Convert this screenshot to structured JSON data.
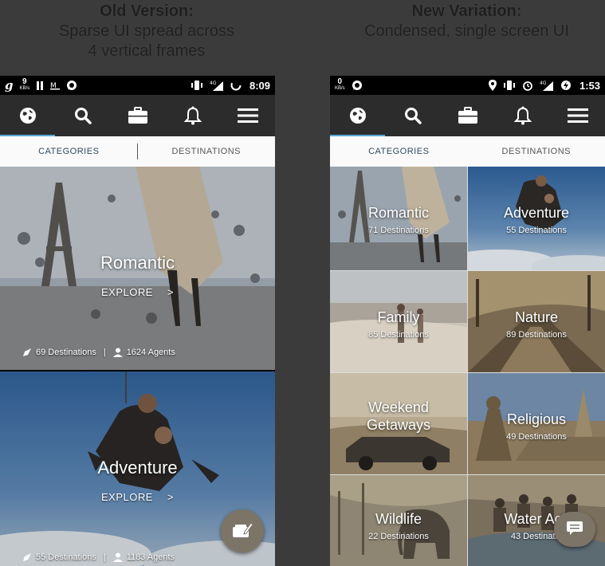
{
  "headings": {
    "old": {
      "title": "Old Version:",
      "line1": "Sparse UI spread across",
      "line2": "4 vertical frames"
    },
    "new": {
      "title": "New Variation:",
      "line1": "Condensed, single screen UI"
    }
  },
  "old_phone": {
    "status": {
      "left_g": "g",
      "kbs_value": "9",
      "kbs_unit": "KB/s",
      "network": "4G",
      "time": "8:09"
    },
    "tabs": {
      "categories": "CATEGORIES",
      "destinations": "DESTINATIONS"
    },
    "cards": [
      {
        "title": "Romantic",
        "explore": "EXPLORE",
        "chevron": ">",
        "destinations": "69 Destinations",
        "separator": "|",
        "agents": "1624 Agents"
      },
      {
        "title": "Adventure",
        "explore": "EXPLORE",
        "chevron": ">",
        "destinations": "55 Destinations",
        "separator": "|",
        "agents": "1183 Agents"
      }
    ]
  },
  "new_phone": {
    "status": {
      "kbs_value": "0",
      "kbs_unit": "KB/s",
      "network": "4G",
      "time": "1:53"
    },
    "tabs": {
      "categories": "CATEGORIES",
      "destinations": "DESTINATIONS"
    },
    "tiles": [
      {
        "title": "Romantic",
        "sub": "71 Destinations"
      },
      {
        "title": "Adventure",
        "sub": "55 Destinations"
      },
      {
        "title": "Family",
        "sub": "85 Destinations"
      },
      {
        "title": "Nature",
        "sub": "89 Destinations"
      },
      {
        "title_line1": "Weekend",
        "title_line2": "Getaways"
      },
      {
        "title": "Religious",
        "sub": "49 Destinations"
      },
      {
        "title": "Wildlife",
        "sub": "22 Destinations"
      },
      {
        "title": "Water Acti",
        "sub": "43 Destinatio"
      }
    ]
  },
  "colors": {
    "background": "#3b3b3b",
    "toolbar": "#2c2c2c",
    "tab_underline": "#5ba8d6",
    "fab": "#7d7468",
    "active_tab_text": "#2f4a66"
  },
  "icons": [
    "globe-icon",
    "search-icon",
    "briefcase-icon",
    "bell-icon",
    "menu-icon",
    "edit-icon",
    "chat-icon",
    "location-icon",
    "alarm-icon",
    "vibrate-icon",
    "signal-icon",
    "battery-icon",
    "pause-icon",
    "whatsapp-icon",
    "plane-icon",
    "agent-icon"
  ]
}
